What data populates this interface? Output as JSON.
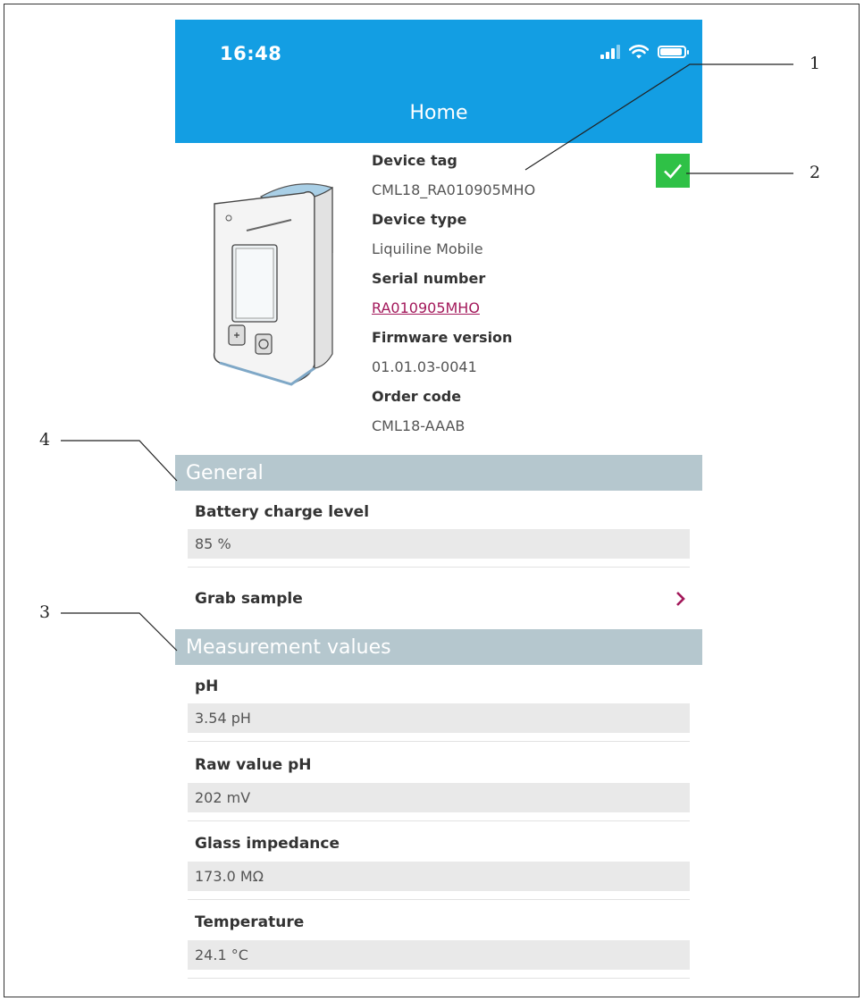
{
  "status_bar": {
    "time": "16:48"
  },
  "nav": {
    "title": "Home"
  },
  "device": {
    "fields": [
      {
        "label": "Device tag",
        "value": "CML18_RA010905MHO"
      },
      {
        "label": "Device type",
        "value": "Liquiline Mobile"
      },
      {
        "label": "Serial number",
        "value": "RA010905MHO"
      },
      {
        "label": "Firmware version",
        "value": "01.01.03-0041"
      },
      {
        "label": "Order code",
        "value": "CML18-AAAB"
      }
    ]
  },
  "sections": {
    "general": {
      "title": "General",
      "battery_label": "Battery charge level",
      "battery_value": "85 %",
      "grab_sample": "Grab sample"
    },
    "measurement": {
      "title": "Measurement values",
      "rows": [
        {
          "label": "pH",
          "value": "3.54 pH"
        },
        {
          "label": "Raw value pH",
          "value": "202 mV"
        },
        {
          "label": "Glass impedance",
          "value": "173.0 MΩ"
        },
        {
          "label": "Temperature",
          "value": "24.1 °C"
        }
      ]
    }
  },
  "callouts": {
    "c1": "1",
    "c2": "2",
    "c3": "3",
    "c4": "4"
  },
  "colors": {
    "appbar": "#139ee3",
    "section_header": "#b5c7ce",
    "ok_check": "#2fc146",
    "link": "#a3195b"
  },
  "icons": [
    "signal-icon",
    "wifi-icon",
    "battery-icon",
    "checkmark-icon",
    "chevron-right-icon"
  ]
}
